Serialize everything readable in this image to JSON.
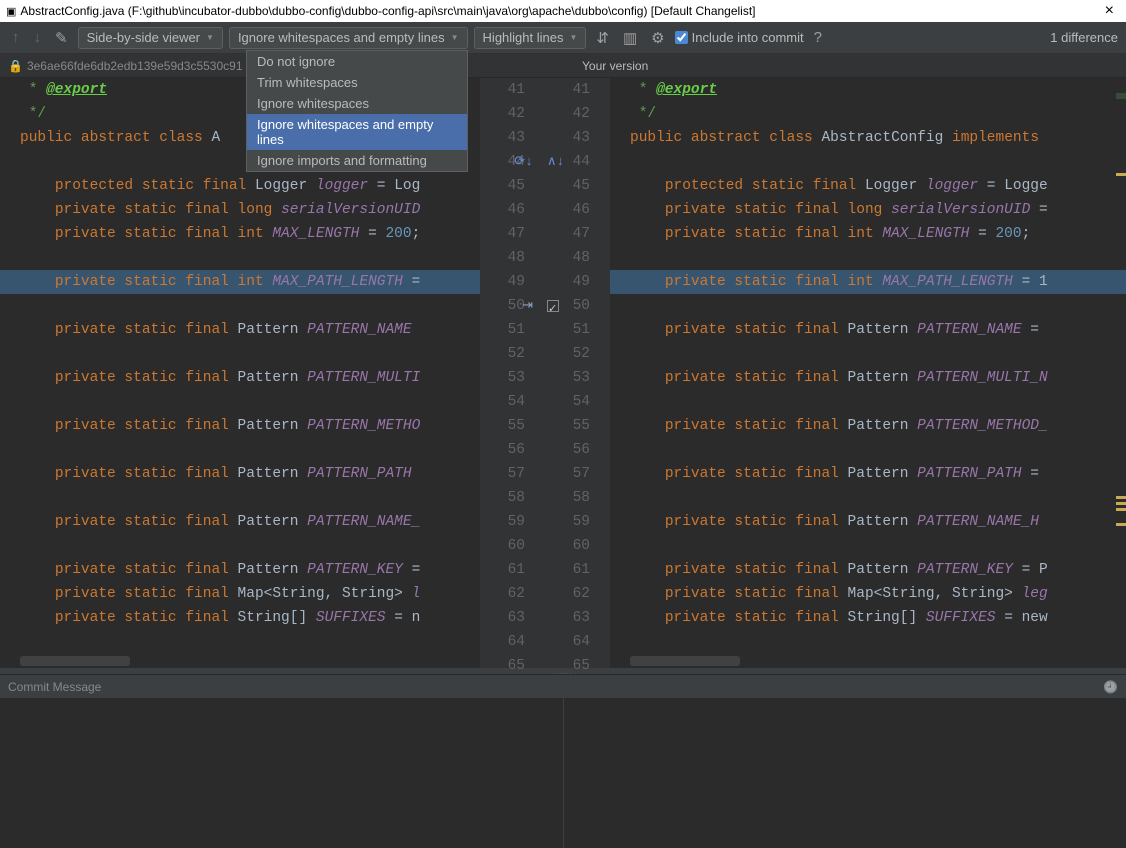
{
  "window": {
    "title": "AbstractConfig.java (F:\\github\\incubator-dubbo\\dubbo-config\\dubbo-config-api\\src\\main\\java\\org\\apache\\dubbo\\config) [Default Changelist]"
  },
  "toolbar": {
    "viewer_mode": "Side-by-side viewer",
    "whitespace_mode": "Ignore whitespaces and empty lines",
    "highlight_mode": "Highlight lines",
    "include_commit_label": "Include into commit",
    "help_label": "?",
    "diff_count": "1 difference"
  },
  "whitespace_menu": {
    "items": [
      "Do not ignore",
      "Trim whitespaces",
      "Ignore whitespaces",
      "Ignore whitespaces and empty lines",
      "Ignore imports and formatting"
    ],
    "selected_index": 3
  },
  "subheader": {
    "left_revision": "3e6ae66fde6db2edb139e59d3c5530c91",
    "right_label": "Your version"
  },
  "gutters": {
    "start": 41,
    "end": 65,
    "highlight": 50
  },
  "left_code": [
    {
      "type": "comment",
      "text": " * ",
      "ann": "@export"
    },
    {
      "type": "comment",
      "text": " */"
    },
    {
      "type": "code",
      "tokens": [
        [
          "kw",
          "public "
        ],
        [
          "kw",
          "abstract "
        ],
        [
          "kw",
          "class "
        ],
        [
          "id",
          "A"
        ]
      ]
    },
    {
      "type": "blank"
    },
    {
      "type": "code",
      "tokens": [
        [
          "",
          "    "
        ],
        [
          "kw",
          "protected static final "
        ],
        [
          "id",
          "Logger "
        ],
        [
          "fld",
          "logger"
        ],
        [
          "id",
          " = Log"
        ]
      ]
    },
    {
      "type": "code",
      "tokens": [
        [
          "",
          "    "
        ],
        [
          "kw",
          "private static final "
        ],
        [
          "kw",
          "long "
        ],
        [
          "fld",
          "serialVersionUID"
        ]
      ]
    },
    {
      "type": "code",
      "tokens": [
        [
          "",
          "    "
        ],
        [
          "kw",
          "private static final "
        ],
        [
          "kw",
          "int "
        ],
        [
          "fld",
          "MAX_LENGTH"
        ],
        [
          "id",
          " = "
        ],
        [
          "num",
          "200"
        ],
        [
          "id",
          ";"
        ]
      ]
    },
    {
      "type": "blank"
    },
    {
      "type": "code",
      "hl": true,
      "tokens": [
        [
          "",
          "    "
        ],
        [
          "kw",
          "private static final "
        ],
        [
          "kw",
          "int "
        ],
        [
          "fld",
          "MAX_PATH_LENGTH"
        ],
        [
          "id",
          " = "
        ]
      ]
    },
    {
      "type": "blank"
    },
    {
      "type": "code",
      "tokens": [
        [
          "",
          "    "
        ],
        [
          "kw",
          "private static final "
        ],
        [
          "id",
          "Pattern "
        ],
        [
          "fld",
          "PATTERN_NAME"
        ]
      ]
    },
    {
      "type": "blank"
    },
    {
      "type": "code",
      "tokens": [
        [
          "",
          "    "
        ],
        [
          "kw",
          "private static final "
        ],
        [
          "id",
          "Pattern "
        ],
        [
          "fld",
          "PATTERN_MULTI"
        ]
      ]
    },
    {
      "type": "blank"
    },
    {
      "type": "code",
      "tokens": [
        [
          "",
          "    "
        ],
        [
          "kw",
          "private static final "
        ],
        [
          "id",
          "Pattern "
        ],
        [
          "fld",
          "PATTERN_METHO"
        ]
      ]
    },
    {
      "type": "blank"
    },
    {
      "type": "code",
      "tokens": [
        [
          "",
          "    "
        ],
        [
          "kw",
          "private static final "
        ],
        [
          "id",
          "Pattern "
        ],
        [
          "fld",
          "PATTERN_PATH"
        ]
      ]
    },
    {
      "type": "blank"
    },
    {
      "type": "code",
      "tokens": [
        [
          "",
          "    "
        ],
        [
          "kw",
          "private static final "
        ],
        [
          "id",
          "Pattern "
        ],
        [
          "fld",
          "PATTERN_NAME_"
        ]
      ]
    },
    {
      "type": "blank"
    },
    {
      "type": "code",
      "tokens": [
        [
          "",
          "    "
        ],
        [
          "kw",
          "private static final "
        ],
        [
          "id",
          "Pattern "
        ],
        [
          "fld",
          "PATTERN_KEY"
        ],
        [
          "id",
          " = "
        ]
      ]
    },
    {
      "type": "code",
      "tokens": [
        [
          "",
          "    "
        ],
        [
          "kw",
          "private static final "
        ],
        [
          "id",
          "Map<String, String> "
        ],
        [
          "fld",
          "l"
        ]
      ]
    },
    {
      "type": "code",
      "tokens": [
        [
          "",
          "    "
        ],
        [
          "kw",
          "private static final "
        ],
        [
          "id",
          "String[] "
        ],
        [
          "fld",
          "SUFFIXES"
        ],
        [
          "id",
          " = n"
        ]
      ]
    },
    {
      "type": "blank"
    }
  ],
  "right_code": [
    {
      "type": "comment",
      "text": " * ",
      "ann": "@export"
    },
    {
      "type": "comment",
      "text": " */"
    },
    {
      "type": "code",
      "tokens": [
        [
          "kw",
          "public "
        ],
        [
          "kw",
          "abstract "
        ],
        [
          "kw",
          "class "
        ],
        [
          "id",
          "AbstractConfig "
        ],
        [
          "kw",
          "implements"
        ]
      ]
    },
    {
      "type": "blank"
    },
    {
      "type": "code",
      "tokens": [
        [
          "",
          "    "
        ],
        [
          "kw",
          "protected static final "
        ],
        [
          "id",
          "Logger "
        ],
        [
          "fld",
          "logger"
        ],
        [
          "id",
          " = Logge"
        ]
      ]
    },
    {
      "type": "code",
      "tokens": [
        [
          "",
          "    "
        ],
        [
          "kw",
          "private static final "
        ],
        [
          "kw",
          "long "
        ],
        [
          "fld",
          "serialVersionUID"
        ],
        [
          "id",
          " ="
        ]
      ]
    },
    {
      "type": "code",
      "tokens": [
        [
          "",
          "    "
        ],
        [
          "kw",
          "private static final "
        ],
        [
          "kw",
          "int "
        ],
        [
          "fld",
          "MAX_LENGTH"
        ],
        [
          "id",
          " = "
        ],
        [
          "num",
          "200"
        ],
        [
          "id",
          ";"
        ]
      ]
    },
    {
      "type": "blank"
    },
    {
      "type": "code",
      "hl": true,
      "tokens": [
        [
          "",
          "    "
        ],
        [
          "kw",
          "private static final "
        ],
        [
          "kw",
          "int "
        ],
        [
          "fld",
          "MAX_PATH_LENGTH"
        ],
        [
          "id",
          " = 1"
        ]
      ]
    },
    {
      "type": "blank"
    },
    {
      "type": "code",
      "tokens": [
        [
          "",
          "    "
        ],
        [
          "kw",
          "private static final "
        ],
        [
          "id",
          "Pattern "
        ],
        [
          "fld",
          "PATTERN_NAME"
        ],
        [
          "id",
          " = "
        ]
      ]
    },
    {
      "type": "blank"
    },
    {
      "type": "code",
      "tokens": [
        [
          "",
          "    "
        ],
        [
          "kw",
          "private static final "
        ],
        [
          "id",
          "Pattern "
        ],
        [
          "fld",
          "PATTERN_MULTI_N"
        ]
      ]
    },
    {
      "type": "blank"
    },
    {
      "type": "code",
      "tokens": [
        [
          "",
          "    "
        ],
        [
          "kw",
          "private static final "
        ],
        [
          "id",
          "Pattern "
        ],
        [
          "fld",
          "PATTERN_METHOD_"
        ]
      ]
    },
    {
      "type": "blank"
    },
    {
      "type": "code",
      "tokens": [
        [
          "",
          "    "
        ],
        [
          "kw",
          "private static final "
        ],
        [
          "id",
          "Pattern "
        ],
        [
          "fld",
          "PATTERN_PATH"
        ],
        [
          "id",
          " ="
        ]
      ]
    },
    {
      "type": "blank"
    },
    {
      "type": "code",
      "tokens": [
        [
          "",
          "    "
        ],
        [
          "kw",
          "private static final "
        ],
        [
          "id",
          "Pattern "
        ],
        [
          "fld",
          "PATTERN_NAME_H"
        ]
      ]
    },
    {
      "type": "blank"
    },
    {
      "type": "code",
      "tokens": [
        [
          "",
          "    "
        ],
        [
          "kw",
          "private static final "
        ],
        [
          "id",
          "Pattern "
        ],
        [
          "fld",
          "PATTERN_KEY"
        ],
        [
          "id",
          " = P"
        ]
      ]
    },
    {
      "type": "code",
      "tokens": [
        [
          "",
          "    "
        ],
        [
          "kw",
          "private static final "
        ],
        [
          "id",
          "Map<String, String> "
        ],
        [
          "fld",
          "leg"
        ]
      ]
    },
    {
      "type": "code",
      "tokens": [
        [
          "",
          "    "
        ],
        [
          "kw",
          "private static final "
        ],
        [
          "id",
          "String[] "
        ],
        [
          "fld",
          "SUFFIXES"
        ],
        [
          "id",
          " = new"
        ]
      ]
    },
    {
      "type": "blank"
    }
  ],
  "commit": {
    "label": "Commit Message"
  }
}
